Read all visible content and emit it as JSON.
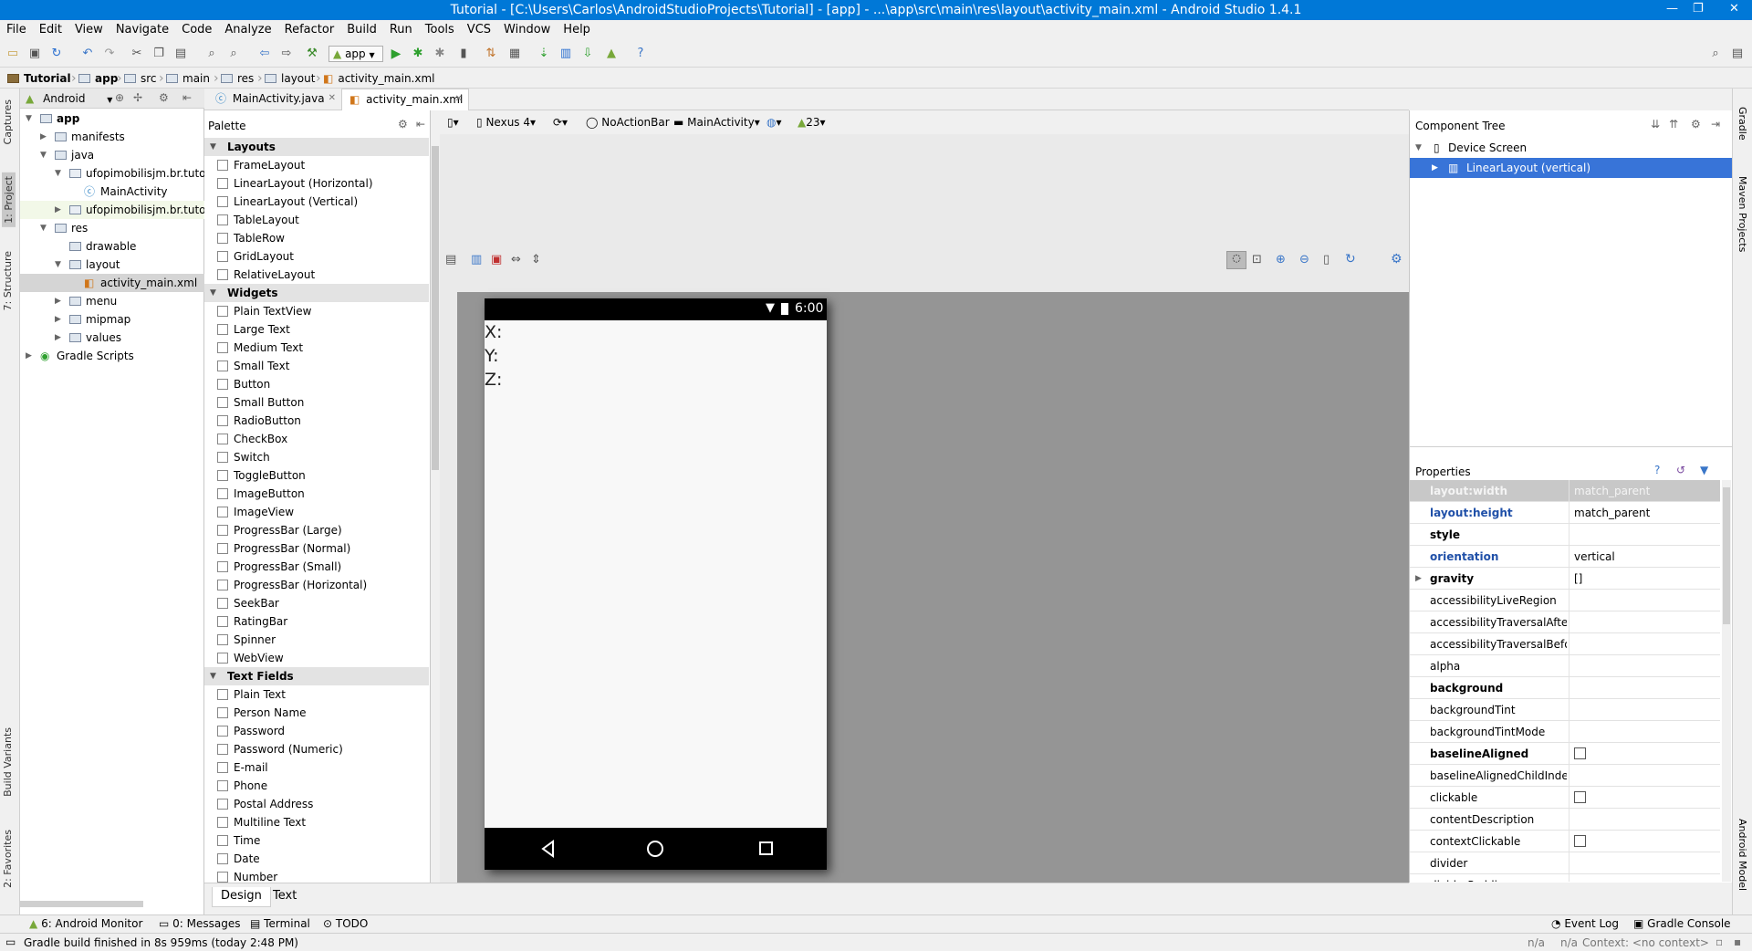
{
  "window": {
    "title": "Tutorial - [C:\\Users\\Carlos\\AndroidStudioProjects\\Tutorial] - [app] - ...\\app\\src\\main\\res\\layout\\activity_main.xml - Android Studio 1.4.1",
    "minimize": "—",
    "restore": "❐",
    "close": "✕"
  },
  "menu": [
    "File",
    "Edit",
    "View",
    "Navigate",
    "Code",
    "Analyze",
    "Refactor",
    "Build",
    "Run",
    "Tools",
    "VCS",
    "Window",
    "Help"
  ],
  "toolbar": {
    "run_config": "app"
  },
  "breadcrumbs": [
    "Tutorial",
    "app",
    "src",
    "main",
    "res",
    "layout",
    "activity_main.xml"
  ],
  "left_tools": {
    "captures": "Captures",
    "project": "1: Project",
    "structure": "7: Structure",
    "build_variants": "Build Variants",
    "favorites": "2: Favorites"
  },
  "project": {
    "view_mode": "Android",
    "tree": [
      {
        "label": "app",
        "level": 0,
        "icon": "folder",
        "expanded": true,
        "bold": true
      },
      {
        "label": "manifests",
        "level": 1,
        "icon": "folder",
        "expanded": false
      },
      {
        "label": "java",
        "level": 1,
        "icon": "folder",
        "expanded": true
      },
      {
        "label": "ufopimobilisjm.br.tutorial",
        "level": 2,
        "icon": "package",
        "expanded": true
      },
      {
        "label": "MainActivity",
        "level": 3,
        "icon": "class"
      },
      {
        "label": "ufopimobilisjm.br.tutorial",
        "level": 2,
        "icon": "package",
        "expanded": false,
        "highlight": true
      },
      {
        "label": "res",
        "level": 1,
        "icon": "folder",
        "expanded": true
      },
      {
        "label": "drawable",
        "level": 2,
        "icon": "folder"
      },
      {
        "label": "layout",
        "level": 2,
        "icon": "folder",
        "expanded": true
      },
      {
        "label": "activity_main.xml",
        "level": 3,
        "icon": "xml",
        "selected": true
      },
      {
        "label": "menu",
        "level": 2,
        "icon": "folder",
        "expanded": false
      },
      {
        "label": "mipmap",
        "level": 2,
        "icon": "folder",
        "expanded": false
      },
      {
        "label": "values",
        "level": 2,
        "icon": "folder",
        "expanded": false
      },
      {
        "label": "Gradle Scripts",
        "level": 0,
        "icon": "gradle",
        "expanded": false
      }
    ]
  },
  "editor_tabs": [
    {
      "label": "MainActivity.java",
      "active": false
    },
    {
      "label": "activity_main.xml",
      "active": true
    }
  ],
  "palette": {
    "title": "Palette",
    "sections": [
      {
        "name": "Layouts",
        "items": [
          "FrameLayout",
          "LinearLayout (Horizontal)",
          "LinearLayout (Vertical)",
          "TableLayout",
          "TableRow",
          "GridLayout",
          "RelativeLayout"
        ]
      },
      {
        "name": "Widgets",
        "items": [
          "Plain TextView",
          "Large Text",
          "Medium Text",
          "Small Text",
          "Button",
          "Small Button",
          "RadioButton",
          "CheckBox",
          "Switch",
          "ToggleButton",
          "ImageButton",
          "ImageView",
          "ProgressBar (Large)",
          "ProgressBar (Normal)",
          "ProgressBar (Small)",
          "ProgressBar (Horizontal)",
          "SeekBar",
          "RatingBar",
          "Spinner",
          "WebView"
        ]
      },
      {
        "name": "Text Fields",
        "items": [
          "Plain Text",
          "Person Name",
          "Password",
          "Password (Numeric)",
          "E-mail",
          "Phone",
          "Postal Address",
          "Multiline Text",
          "Time",
          "Date",
          "Number"
        ]
      }
    ]
  },
  "design_toolbar": {
    "device": "Nexus 4",
    "theme": "NoActionBar",
    "activity": "MainActivity",
    "api": "23"
  },
  "device": {
    "clock": "6:00",
    "texts": [
      "X:",
      "Y:",
      "Z:"
    ]
  },
  "design_tabs": [
    {
      "label": "Design",
      "active": true
    },
    {
      "label": "Text",
      "active": false
    }
  ],
  "component_tree": {
    "title": "Component Tree",
    "root": "Device Screen",
    "child": "LinearLayout (vertical)"
  },
  "properties": {
    "title": "Properties",
    "rows": [
      {
        "name": "layout:width",
        "value": "match_parent",
        "style": "header"
      },
      {
        "name": "layout:height",
        "value": "match_parent",
        "style": "blue"
      },
      {
        "name": "style",
        "value": "",
        "style": "bold"
      },
      {
        "name": "orientation",
        "value": "vertical",
        "style": "blue"
      },
      {
        "name": "gravity",
        "value": "[]",
        "style": "bold",
        "expand": true
      },
      {
        "name": "accessibilityLiveRegion",
        "value": ""
      },
      {
        "name": "accessibilityTraversalAfter",
        "value": ""
      },
      {
        "name": "accessibilityTraversalBefore",
        "value": ""
      },
      {
        "name": "alpha",
        "value": ""
      },
      {
        "name": "background",
        "value": "",
        "style": "bold"
      },
      {
        "name": "backgroundTint",
        "value": ""
      },
      {
        "name": "backgroundTintMode",
        "value": ""
      },
      {
        "name": "baselineAligned",
        "value": "",
        "style": "bold",
        "checkbox": true
      },
      {
        "name": "baselineAlignedChildIndex",
        "value": ""
      },
      {
        "name": "clickable",
        "value": "",
        "checkbox": true
      },
      {
        "name": "contentDescription",
        "value": ""
      },
      {
        "name": "contextClickable",
        "value": "",
        "checkbox": true
      },
      {
        "name": "divider",
        "value": ""
      },
      {
        "name": "dividerPadding",
        "value": ""
      }
    ]
  },
  "right_tools": {
    "gradle": "Gradle",
    "maven": "Maven Projects",
    "android_model": "Android Model"
  },
  "bottom_tools": [
    "6: Android Monitor",
    "0: Messages",
    "Terminal",
    "TODO"
  ],
  "bottom_right_tools": [
    "Event Log",
    "Gradle Console"
  ],
  "status": {
    "message": "Gradle build finished in 8s 959ms (today 2:48 PM)",
    "na1": "n/a",
    "na2": "n/a",
    "context": "Context: <no context>"
  },
  "colors": {
    "title_bg": "#0078d7",
    "selection": "#3874d8",
    "prop_blue": "#2050a8",
    "canvas_gray": "#959595"
  }
}
